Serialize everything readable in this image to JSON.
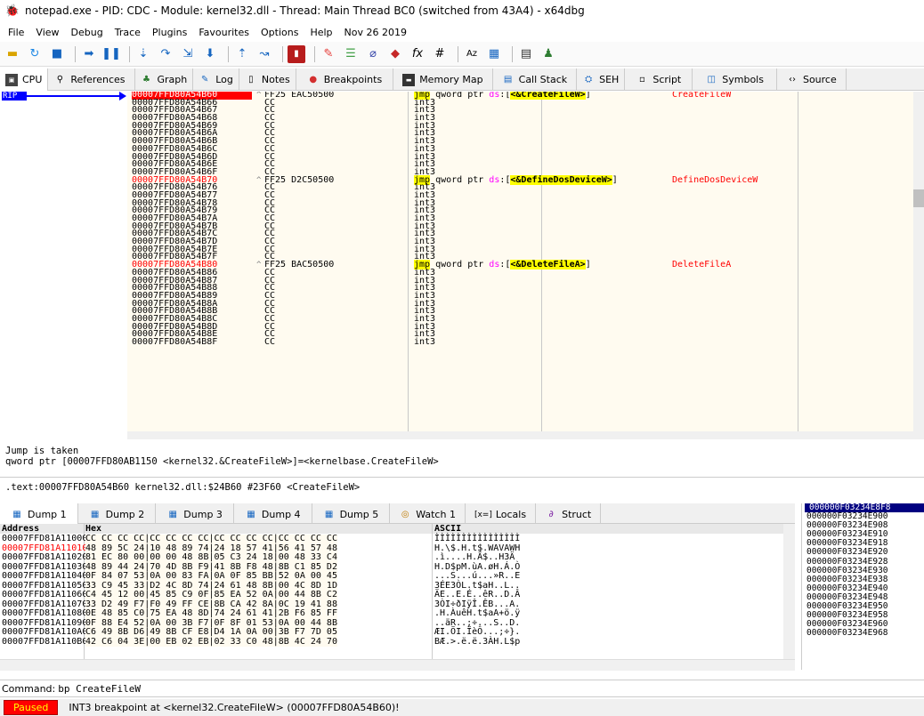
{
  "window": {
    "title": "notepad.exe - PID: CDC - Module: kernel32.dll - Thread: Main Thread BC0 (switched from 43A4) - x64dbg"
  },
  "menu": [
    "File",
    "View",
    "Debug",
    "Trace",
    "Plugins",
    "Favourites",
    "Options",
    "Help",
    "Nov 26 2019"
  ],
  "toolbar_icons": [
    "open-icon",
    "restart-icon",
    "stop-icon",
    "run-icon",
    "pause-icon",
    "step-into-icon",
    "step-over-icon",
    "trace-into-icon",
    "trace-over-icon",
    "execute-till-return-icon",
    "run-to-user-code-icon",
    "scylla-icon",
    "patch-icon",
    "comment-icon",
    "label-icon",
    "bookmark-icon",
    "function-icon",
    "hash-icon",
    "font-icon",
    "calculator-icon",
    "memory-icon",
    "chess-icon"
  ],
  "tabs": [
    {
      "label": "CPU",
      "icon": "cpu-icon"
    },
    {
      "label": "References",
      "icon": "search-icon"
    },
    {
      "label": "Graph",
      "icon": "graph-icon"
    },
    {
      "label": "Log",
      "icon": "log-icon"
    },
    {
      "label": "Notes",
      "icon": "notes-icon"
    },
    {
      "label": "Breakpoints",
      "icon": "breakpoint-icon"
    },
    {
      "label": "Memory Map",
      "icon": "memory-map-icon"
    },
    {
      "label": "Call Stack",
      "icon": "call-stack-icon"
    },
    {
      "label": "SEH",
      "icon": "seh-icon"
    },
    {
      "label": "Script",
      "icon": "script-icon"
    },
    {
      "label": "Symbols",
      "icon": "symbols-icon"
    },
    {
      "label": "Source",
      "icon": "source-icon"
    }
  ],
  "rip_label": "RIP",
  "disasm": [
    {
      "addr": "00007FFD80A54B60",
      "bytes": "FF25 EAC50500",
      "instr_pre": "jmp",
      "instr_mid": " qword ptr ",
      "seg": "ds",
      "instr_post_a": ":[",
      "sym": "<&CreateFileW>",
      "instr_post_b": "]",
      "comment": "CreateFileW",
      "style": "cur",
      "bp": true,
      "arrow": "^"
    },
    {
      "addr": "00007FFD80A54B66",
      "bytes": "CC",
      "instr": "int3"
    },
    {
      "addr": "00007FFD80A54B67",
      "bytes": "CC",
      "instr": "int3"
    },
    {
      "addr": "00007FFD80A54B68",
      "bytes": "CC",
      "instr": "int3"
    },
    {
      "addr": "00007FFD80A54B69",
      "bytes": "CC",
      "instr": "int3"
    },
    {
      "addr": "00007FFD80A54B6A",
      "bytes": "CC",
      "instr": "int3"
    },
    {
      "addr": "00007FFD80A54B6B",
      "bytes": "CC",
      "instr": "int3"
    },
    {
      "addr": "00007FFD80A54B6C",
      "bytes": "CC",
      "instr": "int3"
    },
    {
      "addr": "00007FFD80A54B6D",
      "bytes": "CC",
      "instr": "int3"
    },
    {
      "addr": "00007FFD80A54B6E",
      "bytes": "CC",
      "instr": "int3"
    },
    {
      "addr": "00007FFD80A54B6F",
      "bytes": "CC",
      "instr": "int3"
    },
    {
      "addr": "00007FFD80A54B70",
      "bytes": "FF25 D2C50500",
      "instr_pre": "jmp",
      "instr_mid": " qword ptr ",
      "seg": "ds",
      "instr_post_a": ":[",
      "sym": "<&DefineDosDeviceW>",
      "instr_post_b": "]",
      "comment": "DefineDosDeviceW",
      "style": "hl",
      "arrow": "^"
    },
    {
      "addr": "00007FFD80A54B76",
      "bytes": "CC",
      "instr": "int3"
    },
    {
      "addr": "00007FFD80A54B77",
      "bytes": "CC",
      "instr": "int3"
    },
    {
      "addr": "00007FFD80A54B78",
      "bytes": "CC",
      "instr": "int3"
    },
    {
      "addr": "00007FFD80A54B79",
      "bytes": "CC",
      "instr": "int3"
    },
    {
      "addr": "00007FFD80A54B7A",
      "bytes": "CC",
      "instr": "int3"
    },
    {
      "addr": "00007FFD80A54B7B",
      "bytes": "CC",
      "instr": "int3"
    },
    {
      "addr": "00007FFD80A54B7C",
      "bytes": "CC",
      "instr": "int3"
    },
    {
      "addr": "00007FFD80A54B7D",
      "bytes": "CC",
      "instr": "int3"
    },
    {
      "addr": "00007FFD80A54B7E",
      "bytes": "CC",
      "instr": "int3"
    },
    {
      "addr": "00007FFD80A54B7F",
      "bytes": "CC",
      "instr": "int3"
    },
    {
      "addr": "00007FFD80A54B80",
      "bytes": "FF25 BAC50500",
      "instr_pre": "jmp",
      "instr_mid": " qword ptr ",
      "seg": "ds",
      "instr_post_a": ":[",
      "sym": "<&DeleteFileA>",
      "instr_post_b": "]",
      "comment": "DeleteFileA",
      "style": "hl",
      "arrow": "^"
    },
    {
      "addr": "00007FFD80A54B86",
      "bytes": "CC",
      "instr": "int3"
    },
    {
      "addr": "00007FFD80A54B87",
      "bytes": "CC",
      "instr": "int3"
    },
    {
      "addr": "00007FFD80A54B88",
      "bytes": "CC",
      "instr": "int3"
    },
    {
      "addr": "00007FFD80A54B89",
      "bytes": "CC",
      "instr": "int3"
    },
    {
      "addr": "00007FFD80A54B8A",
      "bytes": "CC",
      "instr": "int3"
    },
    {
      "addr": "00007FFD80A54B8B",
      "bytes": "CC",
      "instr": "int3"
    },
    {
      "addr": "00007FFD80A54B8C",
      "bytes": "CC",
      "instr": "int3"
    },
    {
      "addr": "00007FFD80A54B8D",
      "bytes": "CC",
      "instr": "int3"
    },
    {
      "addr": "00007FFD80A54B8E",
      "bytes": "CC",
      "instr": "int3"
    },
    {
      "addr": "00007FFD80A54B8F",
      "bytes": "CC",
      "instr": "int3"
    }
  ],
  "info": {
    "line1": "Jump is taken",
    "line2": "qword ptr [00007FFD80AB1150 <kernel32.&CreateFileW>]=<kernelbase.CreateFileW>",
    "line3": ".text:00007FFD80A54B60 kernel32.dll:$24B60 #23F60 <CreateFileW>"
  },
  "dump_tabs": [
    {
      "label": "Dump 1",
      "icon": "dump-icon"
    },
    {
      "label": "Dump 2",
      "icon": "dump-icon"
    },
    {
      "label": "Dump 3",
      "icon": "dump-icon"
    },
    {
      "label": "Dump 4",
      "icon": "dump-icon"
    },
    {
      "label": "Dump 5",
      "icon": "dump-icon"
    },
    {
      "label": "Watch 1",
      "icon": "watch-icon"
    },
    {
      "label": "Locals",
      "icon": "locals-icon",
      "prefix": "[x=]"
    },
    {
      "label": "Struct",
      "icon": "struct-icon"
    }
  ],
  "dump_header": {
    "address": "Address",
    "hex": "Hex",
    "ascii": "ASCII"
  },
  "dump_rows": [
    {
      "addr": "00007FFD81A11000",
      "hex": "CC CC CC CC|CC CC CC CC|CC CC CC CC|CC CC CC CC",
      "ascii": "ÌÌÌÌÌÌÌÌÌÌÌÌÌÌÌÌ"
    },
    {
      "addr": "00007FFD81A11010",
      "hex": "48 89 5C 24|10 48 89 74|24 18 57 41|56 41 57 48",
      "ascii": "H.\\$.H.t$.WAVAWH",
      "red": true
    },
    {
      "addr": "00007FFD81A11020",
      "hex": "81 EC 80 00|00 00 48 8B|05 C3 24 18|00 48 33 C4",
      "ascii": ".ì....H.Ã$..H3Ä"
    },
    {
      "addr": "00007FFD81A11030",
      "hex": "48 89 44 24|70 4D 8B F9|41 8B F8 48|8B C1 85 D2",
      "ascii": "H.D$pM.ùA.øH.Á.Ò"
    },
    {
      "addr": "00007FFD81A11040",
      "hex": "0F 84 07 53|0A 00 83 FA|0A 0F 85 BB|52 0A 00 45",
      "ascii": "...S...ú...»R..E"
    },
    {
      "addr": "00007FFD81A11050",
      "hex": "33 C9 45 33|D2 4C 8D 74|24 61 48 8B|00 4C 8D 1D",
      "ascii": "3ÉE3ÒL.t$aH..L.."
    },
    {
      "addr": "00007FFD81A11060",
      "hex": "C4 45 12 00|45 85 C9 0F|85 EA 52 0A|00 44 8B C2",
      "ascii": "ÄE..E.É..êR..D.Â"
    },
    {
      "addr": "00007FFD81A11070",
      "hex": "33 D2 49 F7|F0 49 FF CE|8B CA 42 8A|0C 19 41 88",
      "ascii": "3ÒI÷ðIÿÎ.ÊB...A."
    },
    {
      "addr": "00007FFD81A11080",
      "hex": "0E 48 85 C0|75 EA 48 8D|74 24 61 41|2B F6 85 FF",
      "ascii": ".H.ÀuêH.t$aA+ö.ÿ"
    },
    {
      "addr": "00007FFD81A11090",
      "hex": "0F 88 E4 52|0A 00 3B F7|0F 8F 01 53|0A 00 44 8B",
      "ascii": "..äR..;÷...S..D."
    },
    {
      "addr": "00007FFD81A110A0",
      "hex": "C6 49 8B D6|49 8B CF E8|D4 1A 0A 00|3B F7 7D 05",
      "ascii": "ÆI.ÖI.ÏèÔ...;÷}."
    },
    {
      "addr": "00007FFD81A110B0",
      "hex": "42 C6 04 3E|00 EB 02 EB|02 33 C0 48|8B 4C 24 70",
      "ascii": "BÆ.>.ë.ë.3ÀH.L$p"
    }
  ],
  "stack": [
    "000000F03234E8F8",
    "000000F03234E900",
    "000000F03234E908",
    "000000F03234E910",
    "000000F03234E918",
    "000000F03234E920",
    "000000F03234E928",
    "000000F03234E930",
    "000000F03234E938",
    "000000F03234E940",
    "000000F03234E948",
    "000000F03234E950",
    "000000F03234E958",
    "000000F03234E960",
    "000000F03234E968"
  ],
  "command": {
    "label": "Command:",
    "value": "bp CreateFileW"
  },
  "status": {
    "state": "Paused",
    "message": "INT3 breakpoint at <kernel32.CreateFileW> (00007FFD80A54B60)!"
  }
}
